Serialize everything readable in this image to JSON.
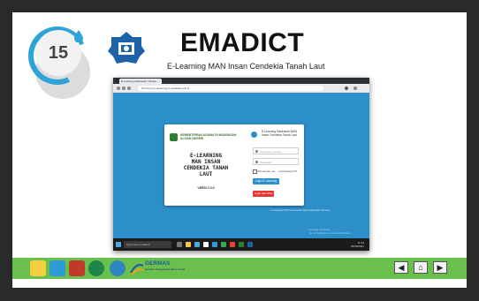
{
  "slide": {
    "number": "15",
    "title": "EMADICT",
    "subtitle": "E-Learning MAN Insan Cendekia Tanah Laut"
  },
  "browser": {
    "tab_title": "E-Learning Madrasah | Websi...",
    "url": "Not secure | elearning.ic-tanahlaut.sch.id"
  },
  "login_card": {
    "ministry_text": "KEMENTERIAN AGAMA RI MADRASAH ALIYAH NEGERI",
    "elearning_lines": [
      "E-LEARNING",
      "MAN INSAN",
      "CENDEKIA TANAH",
      "LAUT"
    ],
    "version": "VERSI 2.0.0",
    "header_text": "E-Learning Madrasah MAN Insan Cendekia Tanah Laut",
    "username_placeholder": "Username / email",
    "password_placeholder": "Password",
    "remember_label": "Remember me",
    "lost_password": "Lost Password?",
    "login_button": "Login E-Learning",
    "sso_button": "Login dari SSO"
  },
  "footer_text": {
    "copyright": "© Copyright 2020 Kementerian Agama Republik Indonesia",
    "activate_title": "Activate Windows",
    "activate_sub": "Go to Settings to activate Windows."
  },
  "taskbar": {
    "search_placeholder": "Type here to search",
    "clock": "11:24",
    "date": "06/08/2021"
  },
  "bottom_strip": {
    "germas_label": "GERMAS",
    "germas_sub": "Gerakan Masyarakat Hidup Sehat",
    "nav": {
      "prev_icon": "◀",
      "home_icon": "⌂",
      "next_icon": "▶"
    }
  },
  "colors": {
    "accent_blue": "#2d8fc9",
    "strip_green": "#6bbf4d",
    "badge_ring": "#2ea3d6"
  }
}
